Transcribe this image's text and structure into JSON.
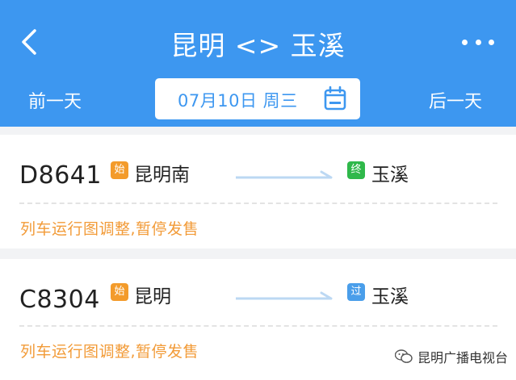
{
  "header": {
    "title": "昆明 <> 玉溪",
    "prev_day": "前一天",
    "next_day": "后一天",
    "date": "07月10日 周三"
  },
  "trains": [
    {
      "number": "D8641",
      "from_badge": "始",
      "from_station": "昆明南",
      "to_badge": "终",
      "to_station": "玉溪",
      "notice": "列车运行图调整,暂停发售"
    },
    {
      "number": "C8304",
      "from_badge": "始",
      "from_station": "昆明",
      "to_badge": "过",
      "to_station": "玉溪",
      "notice": "列车运行图调整,暂停发售"
    }
  ],
  "watermark": {
    "text": "昆明广播电视台"
  },
  "colors": {
    "header_bg": "#3d97f0",
    "start_badge": "#f39b2b",
    "end_badge": "#2fb84a",
    "pass_badge": "#4a9eea",
    "notice": "#f29b38"
  },
  "icons": {
    "back": "chevron-left-icon",
    "more": "more-dots-icon",
    "calendar": "calendar-icon",
    "arrow": "arrow-right-icon"
  }
}
